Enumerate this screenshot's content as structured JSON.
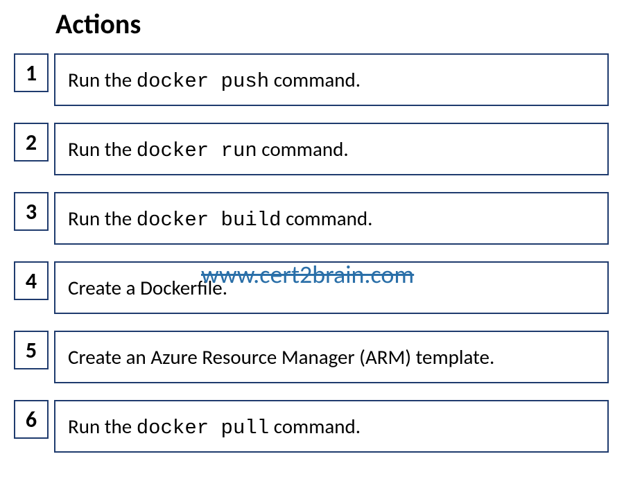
{
  "title": "Actions",
  "watermark": "www.cert2brain.com",
  "items": [
    {
      "num": "1",
      "pre": "Run the ",
      "code": "docker push",
      "post": " command."
    },
    {
      "num": "2",
      "pre": "Run the ",
      "code": "docker run",
      "post": " command."
    },
    {
      "num": "3",
      "pre": "Run the ",
      "code": "docker build",
      "post": " command."
    },
    {
      "num": "4",
      "pre": "Create a Dockerfile.",
      "code": "",
      "post": ""
    },
    {
      "num": "5",
      "pre": "Create an Azure Resource Manager (ARM) template.",
      "code": "",
      "post": ""
    },
    {
      "num": "6",
      "pre": "Run the ",
      "code": "docker pull",
      "post": " command."
    }
  ]
}
